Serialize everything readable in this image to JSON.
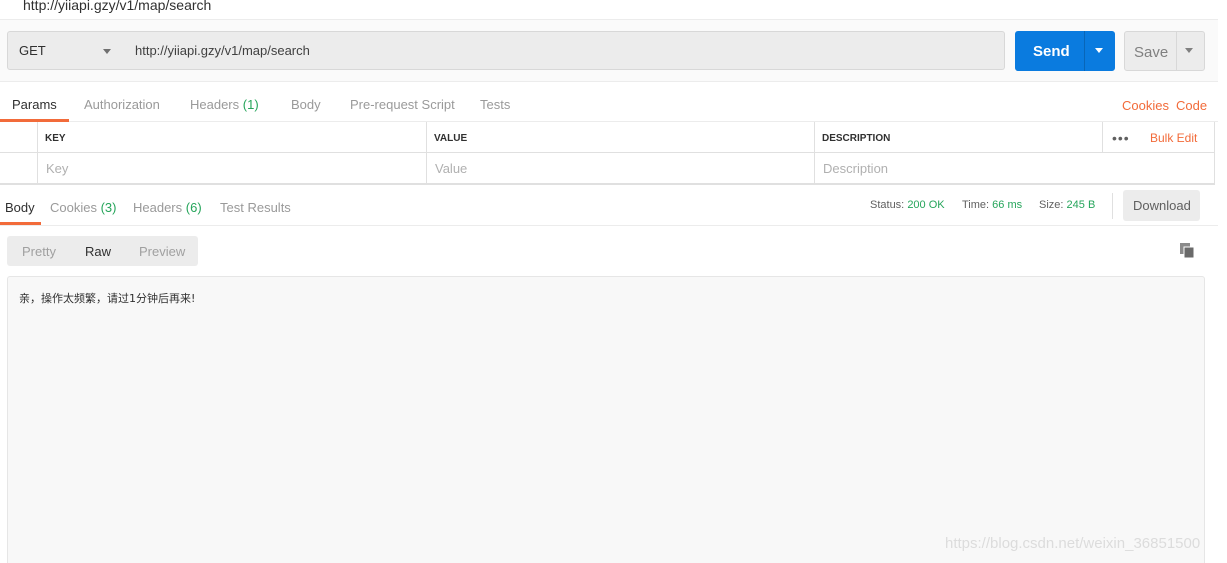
{
  "window": {
    "title": "http://yiiapi.gzy/v1/map/search"
  },
  "request": {
    "method": "GET",
    "url": "http://yiiapi.gzy/v1/map/search",
    "send_label": "Send",
    "save_label": "Save"
  },
  "request_tabs": {
    "params": "Params",
    "authorization": "Authorization",
    "headers": "Headers",
    "headers_count": "(1)",
    "body": "Body",
    "prerequest": "Pre-request Script",
    "tests": "Tests",
    "cookies_link": "Cookies",
    "code_link": "Code"
  },
  "params_table": {
    "headers": {
      "key": "KEY",
      "value": "VALUE",
      "description": "DESCRIPTION"
    },
    "bulk_edit": "Bulk Edit",
    "more_icon": "ellipsis-icon",
    "placeholders": {
      "key": "Key",
      "value": "Value",
      "description": "Description"
    }
  },
  "response_tabs": {
    "body": "Body",
    "cookies": "Cookies",
    "cookies_count": "(3)",
    "headers": "Headers",
    "headers_count": "(6)",
    "test_results": "Test Results"
  },
  "response_meta": {
    "status_label": "Status:",
    "status_value": "200 OK",
    "time_label": "Time:",
    "time_value": "66 ms",
    "size_label": "Size:",
    "size_value": "245 B",
    "download_label": "Download"
  },
  "view_modes": {
    "pretty": "Pretty",
    "raw": "Raw",
    "preview": "Preview",
    "active": "Raw"
  },
  "response_body": "亲，操作太频繁，请过1分钟后再来!",
  "watermark": "https://blog.csdn.net/weixin_36851500",
  "colors": {
    "accent": "#f26b3a",
    "send": "#0a7bdf",
    "success": "#26a55b"
  }
}
